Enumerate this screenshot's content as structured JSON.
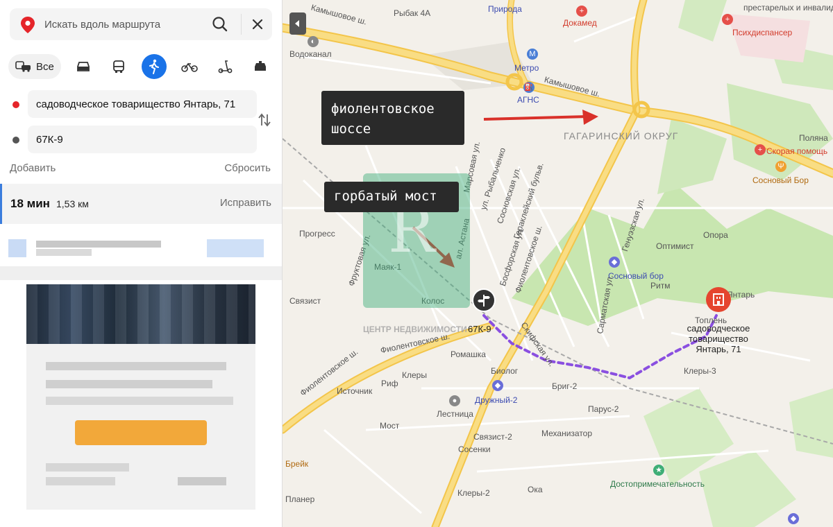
{
  "search": {
    "placeholder": "Искать вдоль маршрута"
  },
  "modes": {
    "all_label": "Все"
  },
  "route": {
    "from": "садоводческое товарищество Янтарь, 71",
    "to": "67К-9",
    "add_label": "Добавить",
    "reset_label": "Сбросить"
  },
  "selected_route": {
    "time": "18 мин",
    "distance": "1,53 км",
    "fix_label": "Исправить"
  },
  "map": {
    "annotation_1": "фиолентовское шоссе",
    "annotation_2": "горбатый мост",
    "stop_label": "67К-9",
    "dest_label": "садоводческое товарищество Янтарь, 71",
    "district": "ГАГАРИНСКИЙ ОКРУГ",
    "watermark_text": "ЦЕНТР НЕДВИЖИМОСТИ",
    "labels": {
      "rybak": "Рыбак 4А",
      "priroda": "Природа",
      "dokamed": "Докамед",
      "prestarelyh": "престарелых и инвалидов",
      "psih": "Психдиспансер",
      "vodokanal": "Водоканал",
      "kamyshovoe_top": "Камышовое ш.",
      "kamyshovoe": "Камышовое ш.",
      "metro": "Метро",
      "agns": "АГНС",
      "polyana": "Поляна",
      "skoraya": "Скорая помощь",
      "sosnovy_bor": "Сосновый Бор",
      "progress": "Прогресс",
      "optimist": "Оптимист",
      "opora": "Опора",
      "sosnovy_bor2": "Сосновый бор",
      "ritm": "Ритм",
      "yantar": "Янтарь",
      "toplenie": "Топлень",
      "svyazist": "Связист",
      "mayak": "Маяк-1",
      "kolos": "Колос",
      "fiolent_sh": "Фиолентовское ш.",
      "fiolent_sh2": "Фиолентовское ш.",
      "romashka": "Ромашка",
      "biolog": "Биолог",
      "klery": "Клеры",
      "druzhny": "Дружный-2",
      "brig": "Бриг-2",
      "klery3": "Клеры-3",
      "rif": "Риф",
      "istochnik": "Источник",
      "lestnica": "Лестница",
      "parus": "Парус-2",
      "most": "Мост",
      "svyazist2": "Связист-2",
      "mehanizator": "Механизатор",
      "sosenki": "Сосенки",
      "breik": "Брейк",
      "dostoprim": "Достопримечательность",
      "planer": "Планер",
      "klery2": "Клеры-2",
      "oka": "Ока",
      "frukt": "Фруктовая ул.",
      "rybalchenko": "ул. Рыбальченко",
      "sosnovskaya": "Сосновская ул.",
      "gerakleyskiy": "Гераклейский бульв.",
      "bosforskaya": "Босфорская ул.",
      "fiolent_vert": "Фиолентовское ш.",
      "skifskaya": "Скифская ул.",
      "sarmatskaya": "Сарматская ул.",
      "genuezskaya": "Генуэзская ул.",
      "astana": "ал. Астана",
      "marsovaya": "Марсовая ул."
    }
  },
  "colors": {
    "accent": "#1a73e8",
    "route": "#8a4fe0",
    "from_dot": "#e5252a",
    "to_dot": "#555555",
    "road": "#f7d46a",
    "park": "#c8e6b0",
    "annotation_bg": "#2a2a2a",
    "arrow": "#d9312a"
  }
}
